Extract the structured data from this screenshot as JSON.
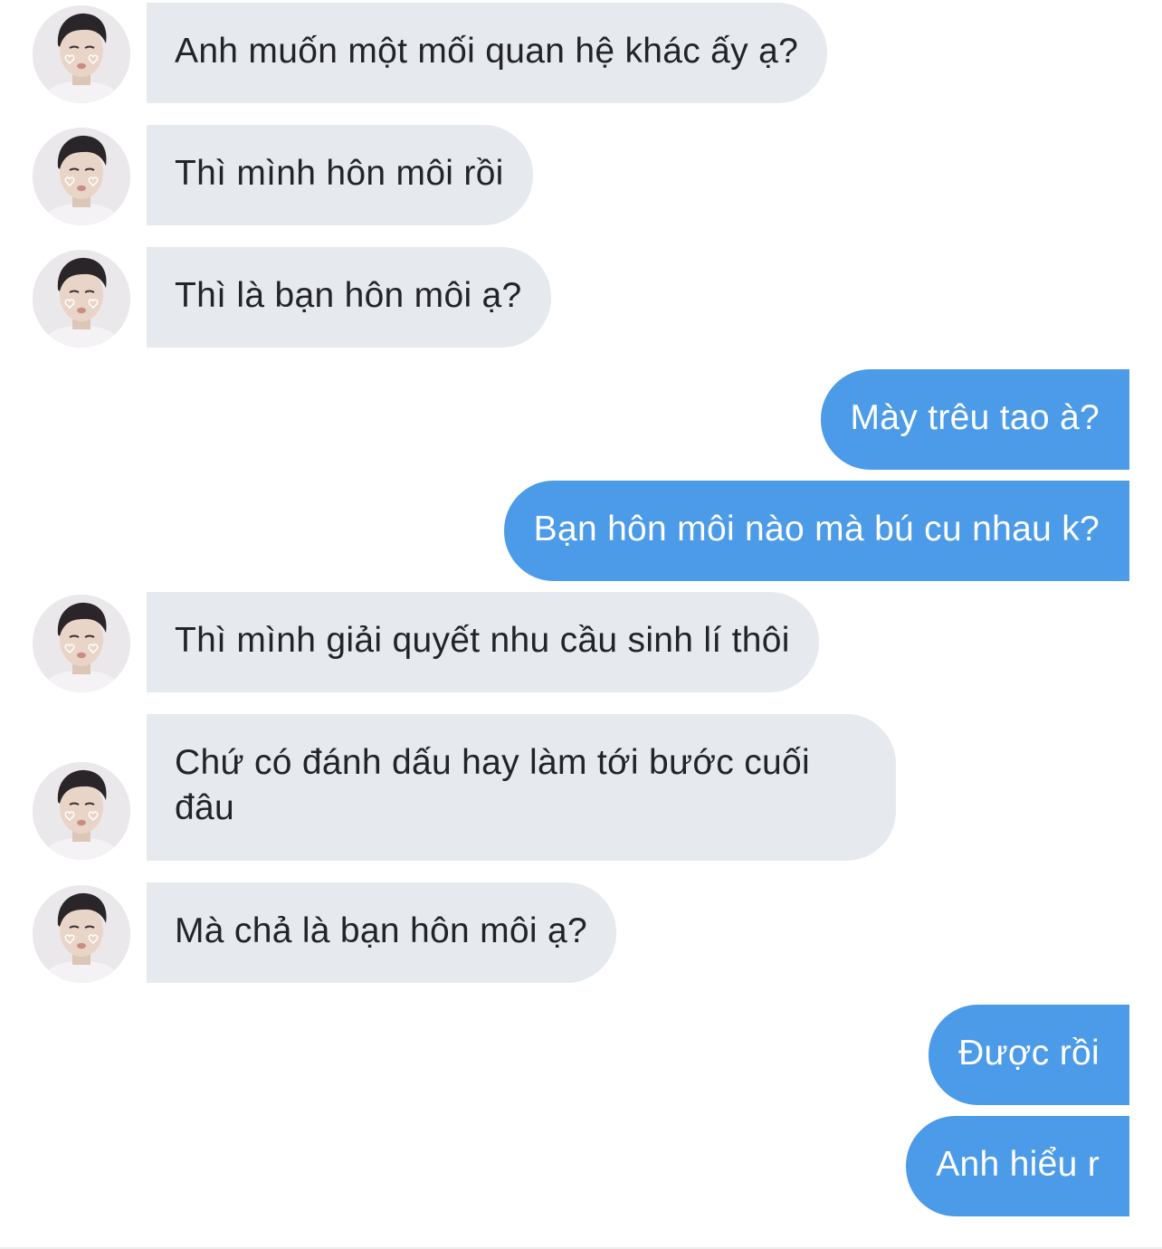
{
  "conversation": {
    "messages": [
      {
        "direction": "incoming",
        "text": "Anh muốn một mối quan hệ khác ấy ạ?"
      },
      {
        "direction": "incoming",
        "text": "Thì mình hôn môi rồi"
      },
      {
        "direction": "incoming",
        "text": "Thì là bạn hôn môi ạ?"
      },
      {
        "direction": "outgoing",
        "text": "Mày trêu tao à?"
      },
      {
        "direction": "outgoing",
        "text": "Bạn hôn môi nào mà bú cu nhau k?"
      },
      {
        "direction": "incoming",
        "text": "Thì mình giải quyết nhu cầu sinh lí thôi"
      },
      {
        "direction": "incoming",
        "text": "Chứ có đánh dấu hay làm tới bước cuối đâu"
      },
      {
        "direction": "incoming",
        "text": "Mà chả là bạn hôn môi ạ?"
      },
      {
        "direction": "outgoing",
        "text": "Được rồi"
      },
      {
        "direction": "outgoing",
        "text": "Anh hiểu r"
      }
    ]
  },
  "colors": {
    "incoming_bubble": "#e6e9ee",
    "incoming_text": "#222428",
    "outgoing_bubble": "#4c9be8",
    "outgoing_text": "#ffffff"
  },
  "icons": {
    "avatar": "contact-avatar-photo"
  }
}
